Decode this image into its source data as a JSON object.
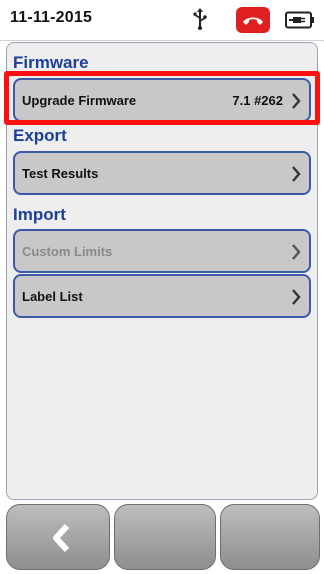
{
  "status": {
    "date": "11-11-2015",
    "icons": [
      "usb-icon",
      "phone-hangup-icon",
      "battery-plugged-icon"
    ]
  },
  "sections": {
    "firmware": {
      "title": "Firmware",
      "items": [
        {
          "label": "Upgrade Firmware",
          "value": "7.1 #262",
          "enabled": true,
          "highlighted": true
        }
      ]
    },
    "export": {
      "title": "Export",
      "items": [
        {
          "label": "Test Results",
          "enabled": true
        }
      ]
    },
    "import": {
      "title": "Import",
      "items": [
        {
          "label": "Custom Limits",
          "enabled": false
        },
        {
          "label": "Label List",
          "enabled": true
        }
      ]
    }
  },
  "bottom_bar": {
    "buttons": [
      "back-button",
      "blank-button-middle",
      "blank-button-right"
    ]
  },
  "colors": {
    "section_title": "#1c3f9c",
    "row_border": "#3a5aa8",
    "row_fill": "#c8c8c8",
    "highlight": "#ff1010",
    "phone_icon": "#e02020"
  }
}
